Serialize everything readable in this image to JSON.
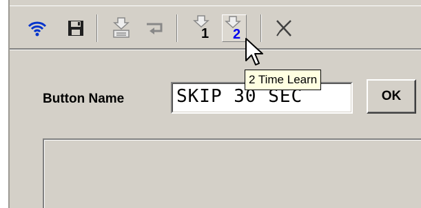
{
  "toolbar": {
    "buttons": [
      {
        "name": "wireless-icon",
        "tooltip": ""
      },
      {
        "name": "save-icon",
        "tooltip": ""
      },
      {
        "name": "print-learn-icon",
        "tooltip": ""
      },
      {
        "name": "return-icon",
        "tooltip": ""
      },
      {
        "name": "learn-1-icon",
        "label": "1"
      },
      {
        "name": "learn-2-icon",
        "label": "2"
      },
      {
        "name": "delete-icon",
        "tooltip": ""
      }
    ],
    "learn1_label": "1",
    "learn2_label": "2",
    "tooltip_text": "2 Time Learn"
  },
  "form": {
    "button_name_label": "Button Name",
    "button_name_value": "SKIP 30 SEC",
    "ok_label": "OK"
  },
  "colors": {
    "window_bg": "#d4d0c8",
    "icon_blue": "#0033cc",
    "tooltip_bg": "#ffffe1",
    "annotation_arrow": "#00cc00"
  }
}
